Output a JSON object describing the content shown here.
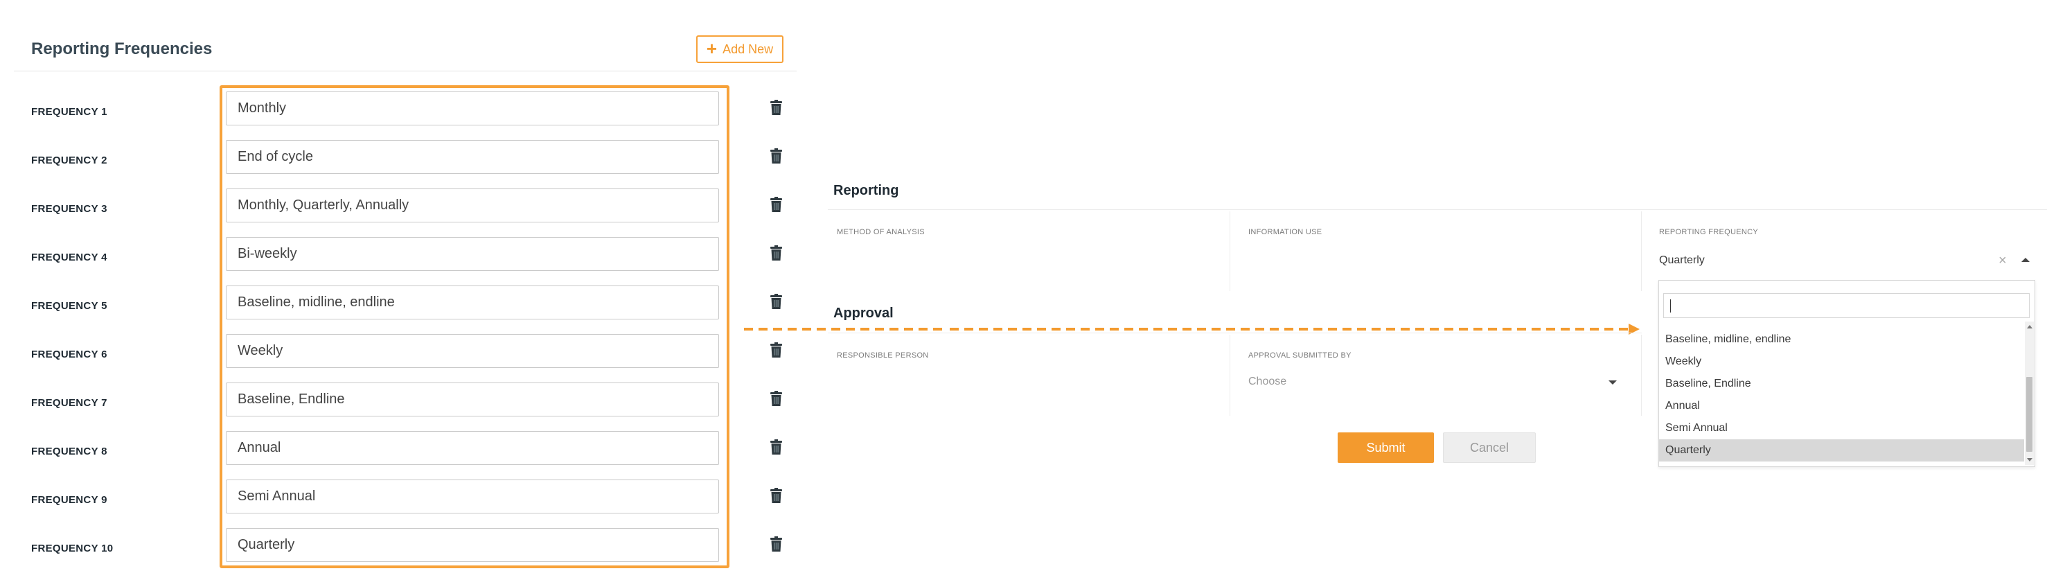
{
  "reporting_frequencies": {
    "title": "Reporting Frequencies",
    "add_new_label": "Add New",
    "add_new_icon": "plus-icon",
    "trash_icon": "trash-icon",
    "accent_color": "#f7a23a",
    "rows": [
      {
        "label": "FREQUENCY 1",
        "value": "Monthly"
      },
      {
        "label": "FREQUENCY 2",
        "value": "End of cycle"
      },
      {
        "label": "FREQUENCY 3",
        "value": "Monthly, Quarterly, Annually"
      },
      {
        "label": "FREQUENCY 4",
        "value": "Bi-weekly"
      },
      {
        "label": "FREQUENCY 5",
        "value": "Baseline, midline, endline"
      },
      {
        "label": "FREQUENCY 6",
        "value": "Weekly"
      },
      {
        "label": "FREQUENCY 7",
        "value": "Baseline, Endline"
      },
      {
        "label": "FREQUENCY 8",
        "value": "Annual"
      },
      {
        "label": "FREQUENCY 9",
        "value": "Semi Annual"
      },
      {
        "label": "FREQUENCY 10",
        "value": "Quarterly"
      }
    ]
  },
  "form": {
    "reporting": {
      "title": "Reporting",
      "method_of_analysis_label": "METHOD OF ANALYSIS",
      "information_use_label": "INFORMATION USE",
      "reporting_frequency_label": "REPORTING FREQUENCY",
      "reporting_frequency_value": "Quarterly",
      "dropdown_search_value": "",
      "dropdown_options": [
        "Baseline, midline, endline",
        "Weekly",
        "Baseline, Endline",
        "Annual",
        "Semi Annual",
        "Quarterly"
      ],
      "dropdown_selected": "Quarterly"
    },
    "approval": {
      "title": "Approval",
      "responsible_person_label": "RESPONSIBLE PERSON",
      "approval_submitted_by_label": "APPROVAL SUBMITTED BY",
      "approval_submitted_by_placeholder": "Choose"
    },
    "submit_label": "Submit",
    "cancel_label": "Cancel",
    "submit_color": "#f39a2e"
  }
}
